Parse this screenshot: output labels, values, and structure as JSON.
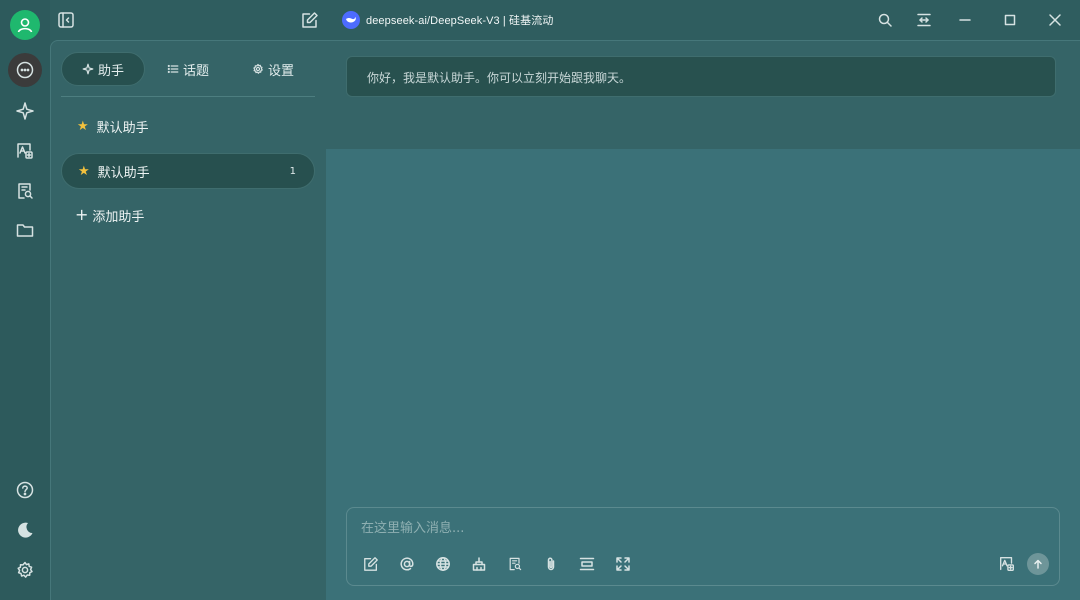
{
  "app": {
    "model_title": "deepseek-ai/DeepSeek-V3 | 硅基流动"
  },
  "rail": {
    "icons": [
      "user-icon",
      "chat-icon",
      "sparkle-icon",
      "translate-icon",
      "search-doc-icon",
      "folder-icon",
      "help-icon",
      "moon-icon",
      "gear-icon"
    ]
  },
  "panel": {
    "tabs": [
      {
        "label": "助手",
        "icon": "sparkle-icon"
      },
      {
        "label": "话题",
        "icon": "list-icon"
      },
      {
        "label": "设置",
        "icon": "gear-icon"
      }
    ],
    "assistants": [
      {
        "label": "默认助手",
        "icon": "star-icon"
      },
      {
        "label": "默认助手",
        "icon": "star-icon",
        "count": "1"
      }
    ],
    "add_label": "添加助手"
  },
  "chat": {
    "welcome": "你好，我是默认助手。你可以立刻开始跟我聊天。",
    "input_placeholder": "在这里输入消息...",
    "tools": [
      "new-topic-icon",
      "mention-icon",
      "web-search-icon",
      "clear-icon",
      "knowledge-icon",
      "attach-icon",
      "expand-line-icon",
      "fullscreen-icon",
      "translate-icon",
      "send-icon"
    ]
  },
  "colors": {
    "background": "#3b7178",
    "panel": "#356467",
    "accent_green": "#1fb86e",
    "star": "#f2c13d",
    "model_logo": "#4d6bfe"
  }
}
